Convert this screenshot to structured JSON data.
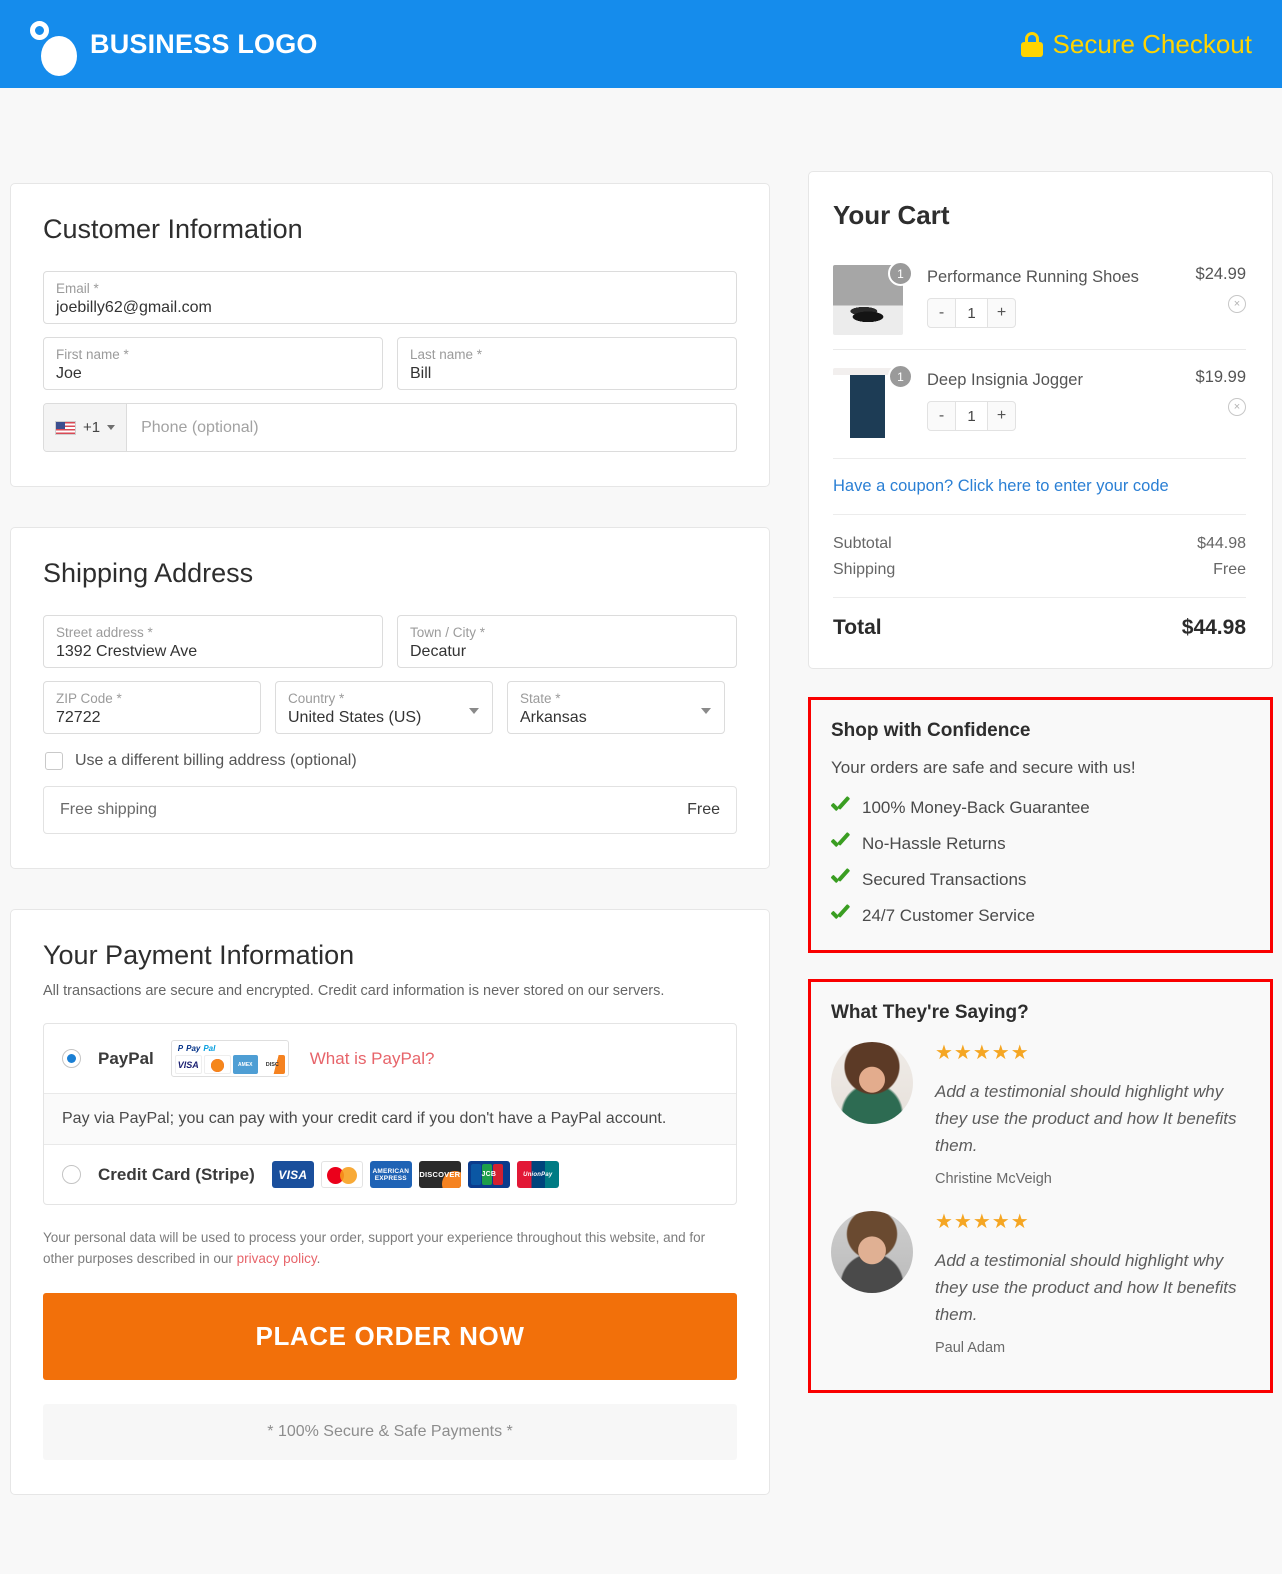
{
  "header": {
    "brand": "BUSINESS LOGO",
    "secure_label": "Secure Checkout",
    "lock_icon": "lock-icon",
    "bg_color": "#158cec",
    "secure_color": "#ffd400"
  },
  "customer": {
    "title": "Customer Information",
    "email": {
      "label": "Email *",
      "value": "joebilly62@gmail.com"
    },
    "first_name": {
      "label": "First name *",
      "value": "Joe"
    },
    "last_name": {
      "label": "Last name *",
      "value": "Bill"
    },
    "phone": {
      "country_code": "+1",
      "flag": "us-flag-icon",
      "placeholder": "Phone (optional)",
      "value": ""
    }
  },
  "shipping": {
    "title": "Shipping Address",
    "street": {
      "label": "Street address *",
      "value": "1392 Crestview Ave"
    },
    "city": {
      "label": "Town / City *",
      "value": "Decatur"
    },
    "zip": {
      "label": "ZIP Code *",
      "value": "72722"
    },
    "country": {
      "label": "Country *",
      "value": "United States (US)"
    },
    "state": {
      "label": "State *",
      "value": "Arkansas"
    },
    "billing_checkbox": "Use a different billing address (optional)",
    "method_label": "Free shipping",
    "method_price": "Free"
  },
  "payment": {
    "title": "Your Payment Information",
    "subtitle": "All transactions are secure and encrypted. Credit card information is never stored on our servers.",
    "paypal": {
      "name": "PayPal",
      "what_is": "What is PayPal?",
      "note": "Pay via PayPal; you can pay with your credit card if you don't have a PayPal account.",
      "selected": true,
      "badge_cards": [
        "VISA",
        "MC",
        "AMEX",
        "DISC"
      ]
    },
    "stripe": {
      "name": "Credit Card (Stripe)",
      "selected": false,
      "cards": [
        "VISA",
        "Mastercard",
        "American Express",
        "Discover",
        "JCB",
        "UnionPay"
      ]
    },
    "privacy_text": "Your personal data will be used to process your order, support your experience throughout this website, and for other purposes described in our ",
    "privacy_link": "privacy policy",
    "privacy_end": ".",
    "place_order": "PLACE ORDER NOW",
    "secure_footer": "* 100% Secure & Safe Payments *",
    "button_color": "#f2700a"
  },
  "cart": {
    "title": "Your Cart",
    "items": [
      {
        "name": "Performance Running Shoes",
        "price": "$24.99",
        "qty": "1",
        "badge": "1",
        "thumb": "running-shoes-thumbnail",
        "minus": "-",
        "plus": "+",
        "remove": "×"
      },
      {
        "name": "Deep Insignia Jogger",
        "price": "$19.99",
        "qty": "1",
        "badge": "1",
        "thumb": "jogger-pants-thumbnail",
        "minus": "-",
        "plus": "+",
        "remove": "×"
      }
    ],
    "coupon_link": "Have a coupon? Click here to enter your code",
    "subtotal_label": "Subtotal",
    "subtotal_value": "$44.98",
    "shipping_label": "Shipping",
    "shipping_value": "Free",
    "total_label": "Total",
    "total_value": "$44.98"
  },
  "confidence": {
    "title": "Shop with Confidence",
    "subtitle": "Your orders are safe and secure with us!",
    "border_color": "#fa0000",
    "check_color": "#3a9e22",
    "items": [
      "100% Money-Back Guarantee",
      "No-Hassle Returns",
      "Secured Transactions",
      "24/7 Customer Service"
    ]
  },
  "testimonials": {
    "title": "What They're Saying?",
    "border_color": "#fa0000",
    "star_color": "#f5a623",
    "items": [
      {
        "stars": "★★★★★",
        "quote": "Add a testimonial should highlight why they use the product and how It benefits them.",
        "name": "Christine McVeigh",
        "avatar": "woman-avatar"
      },
      {
        "stars": "★★★★★",
        "quote": "Add a testimonial should highlight why they use the product and how It benefits them.",
        "name": "Paul Adam",
        "avatar": "man-avatar"
      }
    ]
  }
}
